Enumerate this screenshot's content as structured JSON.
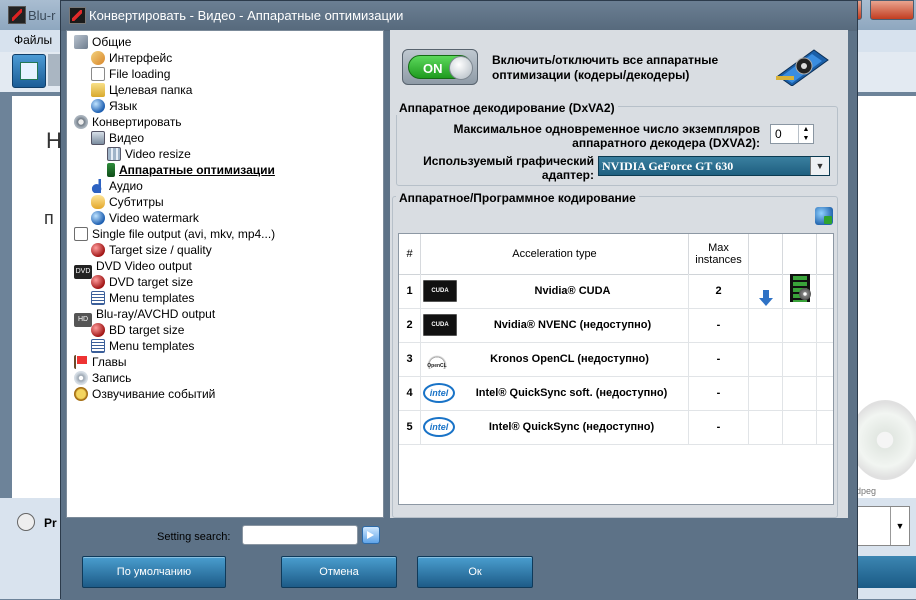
{
  "background_app": {
    "title": "Blu-r",
    "menu_files": "Файлы",
    "hint_line1": "Н",
    "hint_line2": "п",
    "preset_label": "Pr",
    "dropdown_value": ")",
    "disc_text": "dpeg"
  },
  "dialog": {
    "title": "Конвертировать - Видео - Аппаратные оптимизации"
  },
  "tree": [
    {
      "label": "Общие",
      "icon": "tools-icon"
    },
    {
      "label": "Интерфейс",
      "icon": "interface-icon"
    },
    {
      "label": "File loading",
      "icon": "file-icon"
    },
    {
      "label": "Целевая папка",
      "icon": "folder-icon"
    },
    {
      "label": "Язык",
      "icon": "globe-icon"
    },
    {
      "label": "Конвертировать",
      "icon": "convert-icon"
    },
    {
      "label": "Видео",
      "icon": "video-icon"
    },
    {
      "label": "Video resize",
      "icon": "resize-icon"
    },
    {
      "label": "Аппаратные оптимизации",
      "icon": "hardware-icon",
      "selected": true
    },
    {
      "label": "Аудио",
      "icon": "audio-icon"
    },
    {
      "label": "Субтитры",
      "icon": "subtitles-icon"
    },
    {
      "label": "Video watermark",
      "icon": "globe-icon"
    },
    {
      "label": "Single file output (avi, mkv, mp4...)",
      "icon": "single-file-icon"
    },
    {
      "label": "Target size / quality",
      "icon": "target-icon"
    },
    {
      "label": "DVD Video output",
      "icon": "dvd-icon"
    },
    {
      "label": "DVD target size",
      "icon": "target-icon"
    },
    {
      "label": "Menu templates",
      "icon": "menu-template-icon"
    },
    {
      "label": "Blu-ray/AVCHD output",
      "icon": "hd-icon"
    },
    {
      "label": "BD target size",
      "icon": "target-icon"
    },
    {
      "label": "Menu templates",
      "icon": "menu-template-icon"
    },
    {
      "label": "Главы",
      "icon": "flag-icon"
    },
    {
      "label": "Запись",
      "icon": "record-icon"
    },
    {
      "label": "Озвучивание событий",
      "icon": "sound-icon"
    }
  ],
  "toggle": {
    "label": "ON",
    "description": "Включить/отключить все аппаратные оптимизации (кодеры/декодеры)",
    "on_color": "#2fb52f"
  },
  "decoding_group": {
    "title": "Аппаратное декодирование (DxVA2)",
    "max_instances_label": "Максимальное одновременное число экземпляров аппаратного декодера (DXVA2):",
    "max_instances_value": "0",
    "gpu_label": "Используемый графический адаптер:",
    "gpu_value": "NVIDIA GeForce GT 630"
  },
  "encoding_group": {
    "title": "Аппаратное/Программное кодирование",
    "columns": {
      "num": "#",
      "type": "Acceleration type",
      "max": "Max instances"
    },
    "rows": [
      {
        "num": "1",
        "brand": "CUDA",
        "brand_icon": "nvidia-cuda-icon",
        "type": "Nvidia® CUDA",
        "max": "2"
      },
      {
        "num": "2",
        "brand": "CUDA",
        "brand_icon": "nvidia-cuda-icon",
        "type": "Nvidia® NVENC (недоступно)",
        "max": "-"
      },
      {
        "num": "3",
        "brand": "OpenCL",
        "brand_icon": "opencl-icon",
        "type": "Kronos OpenCL (недоступно)",
        "max": "-"
      },
      {
        "num": "4",
        "brand": "intel",
        "brand_icon": "intel-icon",
        "type": "Intel® QuickSync soft. (недоступно)",
        "max": "-"
      },
      {
        "num": "5",
        "brand": "intel",
        "brand_icon": "intel-icon",
        "type": "Intel® QuickSync (недоступно)",
        "max": "-"
      }
    ]
  },
  "search": {
    "label": "Setting search:",
    "placeholder": ""
  },
  "buttons": {
    "default": "По умолчанию",
    "cancel": "Отмена",
    "ok": "Ок"
  }
}
